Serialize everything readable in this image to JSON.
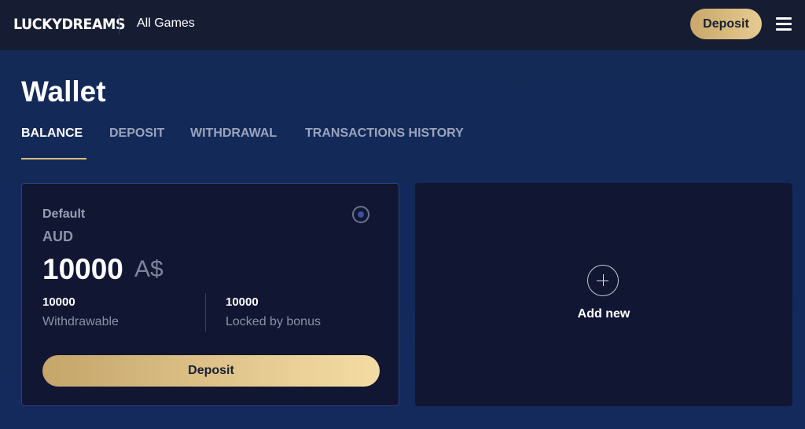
{
  "header": {
    "logo": "LUCKYDREAMS",
    "nav_all_games": "All Games",
    "deposit_label": "Deposit"
  },
  "page": {
    "title": "Wallet"
  },
  "tabs": [
    {
      "label": "BALANCE",
      "active": true
    },
    {
      "label": "DEPOSIT",
      "active": false
    },
    {
      "label": "WITHDRAWAL",
      "active": false
    },
    {
      "label": "TRANSACTIONS HISTORY",
      "active": false
    }
  ],
  "wallet": {
    "label": "Default",
    "currency": "AUD",
    "amount": "10000",
    "symbol": "A$",
    "withdrawable_value": "10000",
    "withdrawable_label": "Withdrawable",
    "locked_value": "10000",
    "locked_label": "Locked by bonus",
    "deposit_label": "Deposit"
  },
  "add_new": {
    "label": "Add new"
  },
  "colors": {
    "background": "#132955",
    "header": "#161d33",
    "card": "#111632",
    "gold_start": "#c4a56a",
    "gold_end": "#f3dca3",
    "tab_inactive": "#9aa4bd"
  },
  "icons": {
    "menu": "hamburger-menu-icon",
    "add": "plus-circle-icon",
    "default_radio": "radio-selected-icon"
  }
}
